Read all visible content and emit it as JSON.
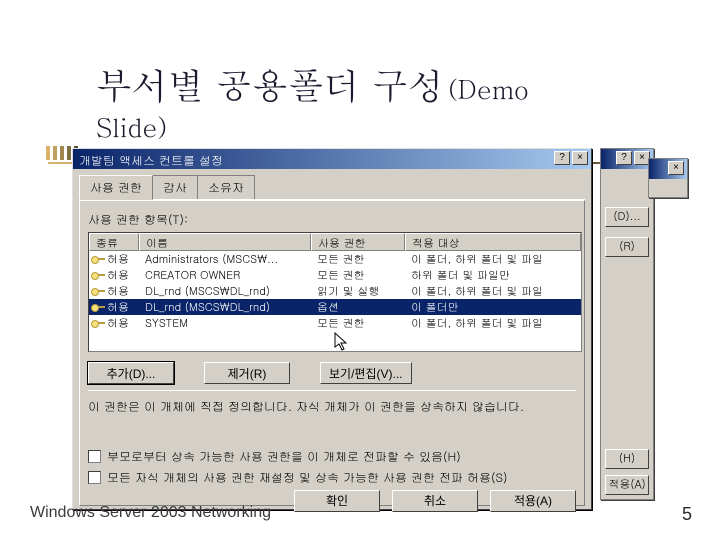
{
  "slide": {
    "title": "부서별 공용폴더 구성",
    "title_suffix": "(Demo",
    "title_line2": "Slide)",
    "footer": "Windows Server 2003 Networking",
    "page_number": "5"
  },
  "dialog": {
    "title": "개발팀 액세스 컨트롤 설정",
    "help_btn": "?",
    "close_btn": "×",
    "tabs": [
      "사용 권한",
      "감사",
      "소유자"
    ],
    "active_tab": 0,
    "list_label": "사용 권한 항목(T):",
    "columns": [
      "종류",
      "이름",
      "사용 권한",
      "적용 대상"
    ],
    "rows": [
      {
        "type": "허용",
        "name": "Administrators (MSCS\\...",
        "perm": "모든 권한",
        "target": "이 폴더, 하위 폴더 및 파일"
      },
      {
        "type": "허용",
        "name": "CREATOR OWNER",
        "perm": "모든 권한",
        "target": "하위 폴더 및 파일만"
      },
      {
        "type": "허용",
        "name": "DL_rnd (MSCS\\DL_rnd)",
        "perm": "읽기 및 실행",
        "target": "이 폴더, 하위 폴더 및 파일"
      },
      {
        "type": "허용",
        "name": "DL_rnd (MSCS\\DL_rnd)",
        "perm": "옵션",
        "target": "이 폴더만",
        "selected": true
      },
      {
        "type": "허용",
        "name": "SYSTEM",
        "perm": "모든 권한",
        "target": "이 폴더, 하위 폴더 및 파일"
      }
    ],
    "buttons": {
      "add": "추가(D)...",
      "remove": "제거(R)",
      "view": "보기/편집(V)..."
    },
    "note": "이 권한은 이 개체에 직접 정의합니다. 자식 개체가 이 권한을 상속하지 않습니다.",
    "check1": "부모로부터 상속 가능한 사용 권한을 이 개체로 전파할 수 있음(H)",
    "check2": "모든 자식 개체의 사용 권한 재설정 및 상속 가능한 사용 권한 전파 허용(S)",
    "ok": "확인",
    "cancel": "취소",
    "apply": "적용(A)"
  },
  "back_buttons": {
    "d": "(D)...",
    "r": "(R)",
    "h": "(H)",
    "a": "적용(A)"
  }
}
